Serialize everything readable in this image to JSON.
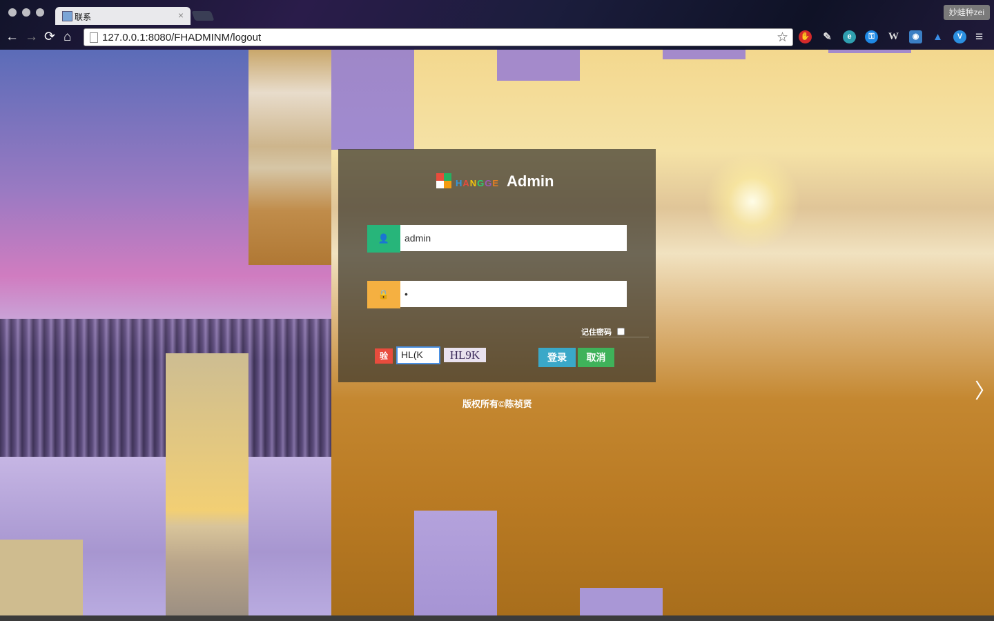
{
  "browser": {
    "tab_title": "联系",
    "tab_close": "×",
    "profile_name": "妙蛙种zei",
    "url": "127.0.0.1:8080/FHADMINM/logout",
    "nav": {
      "back": "←",
      "forward": "→",
      "reload": "⟳",
      "home": "⌂",
      "menu": "≡"
    },
    "extensions": [
      "adblock-icon",
      "feather-icon",
      "e-icon",
      "key-icon",
      "w-icon",
      "square-icon",
      "cap-icon",
      "v-icon"
    ],
    "extension_labels": {
      "adblock": "✋",
      "e": "e",
      "key": "⚿",
      "w": "W",
      "square": "◉",
      "cap": "▲",
      "v": "V"
    }
  },
  "login": {
    "logo_brand": "HANGGE",
    "logo_title": "Admin",
    "username_value": "admin",
    "password_value": "•",
    "remember_label": "记住密码",
    "code_tag": "验",
    "code_value": "HL(K",
    "captcha_text": "HL9K",
    "login_button": "登录",
    "cancel_button": "取消"
  },
  "footer": {
    "copyright": "版权所有©陈祯贤"
  },
  "colors": {
    "user_icon_bg": "#27b57a",
    "lock_icon_bg": "#f5b041",
    "login_btn": "#3aa8c8",
    "cancel_btn": "#3fb25a"
  }
}
